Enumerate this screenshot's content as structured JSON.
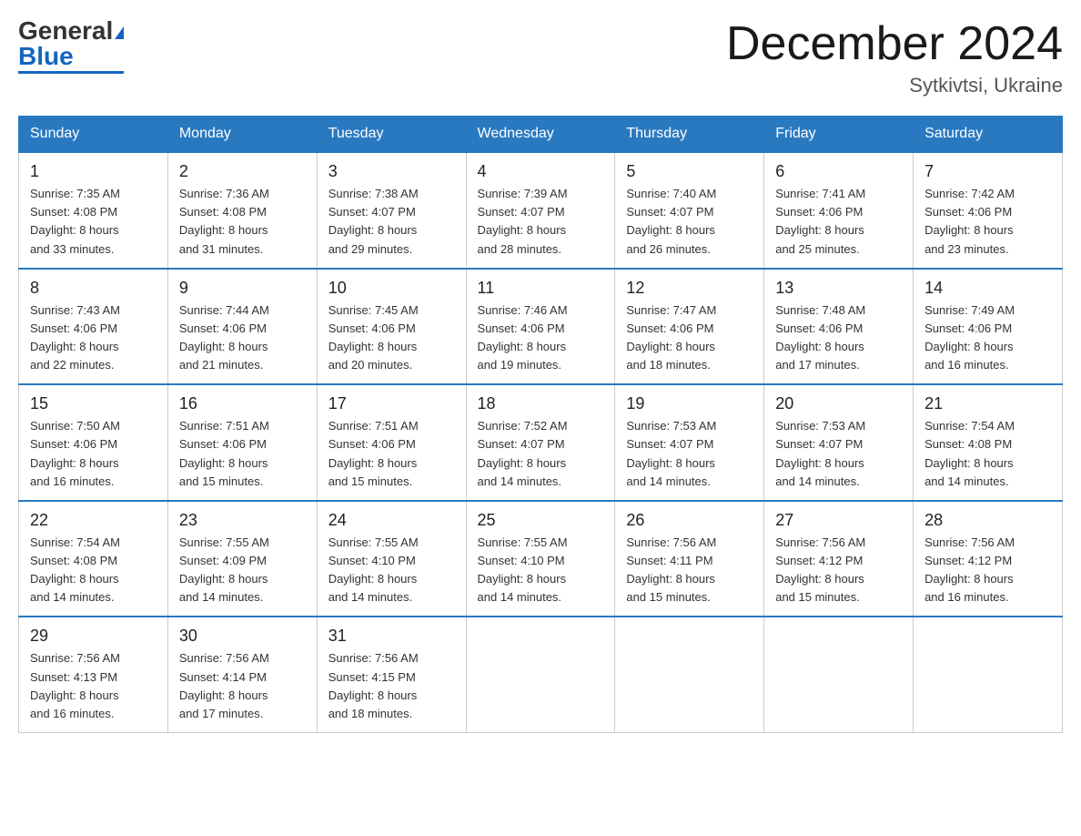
{
  "header": {
    "logo_general": "General",
    "logo_blue": "Blue",
    "month_title": "December 2024",
    "location": "Sytkivtsi, Ukraine"
  },
  "weekdays": [
    "Sunday",
    "Monday",
    "Tuesday",
    "Wednesday",
    "Thursday",
    "Friday",
    "Saturday"
  ],
  "weeks": [
    [
      {
        "day": "1",
        "sunrise": "7:35 AM",
        "sunset": "4:08 PM",
        "daylight": "8 hours and 33 minutes."
      },
      {
        "day": "2",
        "sunrise": "7:36 AM",
        "sunset": "4:08 PM",
        "daylight": "8 hours and 31 minutes."
      },
      {
        "day": "3",
        "sunrise": "7:38 AM",
        "sunset": "4:07 PM",
        "daylight": "8 hours and 29 minutes."
      },
      {
        "day": "4",
        "sunrise": "7:39 AM",
        "sunset": "4:07 PM",
        "daylight": "8 hours and 28 minutes."
      },
      {
        "day": "5",
        "sunrise": "7:40 AM",
        "sunset": "4:07 PM",
        "daylight": "8 hours and 26 minutes."
      },
      {
        "day": "6",
        "sunrise": "7:41 AM",
        "sunset": "4:06 PM",
        "daylight": "8 hours and 25 minutes."
      },
      {
        "day": "7",
        "sunrise": "7:42 AM",
        "sunset": "4:06 PM",
        "daylight": "8 hours and 23 minutes."
      }
    ],
    [
      {
        "day": "8",
        "sunrise": "7:43 AM",
        "sunset": "4:06 PM",
        "daylight": "8 hours and 22 minutes."
      },
      {
        "day": "9",
        "sunrise": "7:44 AM",
        "sunset": "4:06 PM",
        "daylight": "8 hours and 21 minutes."
      },
      {
        "day": "10",
        "sunrise": "7:45 AM",
        "sunset": "4:06 PM",
        "daylight": "8 hours and 20 minutes."
      },
      {
        "day": "11",
        "sunrise": "7:46 AM",
        "sunset": "4:06 PM",
        "daylight": "8 hours and 19 minutes."
      },
      {
        "day": "12",
        "sunrise": "7:47 AM",
        "sunset": "4:06 PM",
        "daylight": "8 hours and 18 minutes."
      },
      {
        "day": "13",
        "sunrise": "7:48 AM",
        "sunset": "4:06 PM",
        "daylight": "8 hours and 17 minutes."
      },
      {
        "day": "14",
        "sunrise": "7:49 AM",
        "sunset": "4:06 PM",
        "daylight": "8 hours and 16 minutes."
      }
    ],
    [
      {
        "day": "15",
        "sunrise": "7:50 AM",
        "sunset": "4:06 PM",
        "daylight": "8 hours and 16 minutes."
      },
      {
        "day": "16",
        "sunrise": "7:51 AM",
        "sunset": "4:06 PM",
        "daylight": "8 hours and 15 minutes."
      },
      {
        "day": "17",
        "sunrise": "7:51 AM",
        "sunset": "4:06 PM",
        "daylight": "8 hours and 15 minutes."
      },
      {
        "day": "18",
        "sunrise": "7:52 AM",
        "sunset": "4:07 PM",
        "daylight": "8 hours and 14 minutes."
      },
      {
        "day": "19",
        "sunrise": "7:53 AM",
        "sunset": "4:07 PM",
        "daylight": "8 hours and 14 minutes."
      },
      {
        "day": "20",
        "sunrise": "7:53 AM",
        "sunset": "4:07 PM",
        "daylight": "8 hours and 14 minutes."
      },
      {
        "day": "21",
        "sunrise": "7:54 AM",
        "sunset": "4:08 PM",
        "daylight": "8 hours and 14 minutes."
      }
    ],
    [
      {
        "day": "22",
        "sunrise": "7:54 AM",
        "sunset": "4:08 PM",
        "daylight": "8 hours and 14 minutes."
      },
      {
        "day": "23",
        "sunrise": "7:55 AM",
        "sunset": "4:09 PM",
        "daylight": "8 hours and 14 minutes."
      },
      {
        "day": "24",
        "sunrise": "7:55 AM",
        "sunset": "4:10 PM",
        "daylight": "8 hours and 14 minutes."
      },
      {
        "day": "25",
        "sunrise": "7:55 AM",
        "sunset": "4:10 PM",
        "daylight": "8 hours and 14 minutes."
      },
      {
        "day": "26",
        "sunrise": "7:56 AM",
        "sunset": "4:11 PM",
        "daylight": "8 hours and 15 minutes."
      },
      {
        "day": "27",
        "sunrise": "7:56 AM",
        "sunset": "4:12 PM",
        "daylight": "8 hours and 15 minutes."
      },
      {
        "day": "28",
        "sunrise": "7:56 AM",
        "sunset": "4:12 PM",
        "daylight": "8 hours and 16 minutes."
      }
    ],
    [
      {
        "day": "29",
        "sunrise": "7:56 AM",
        "sunset": "4:13 PM",
        "daylight": "8 hours and 16 minutes."
      },
      {
        "day": "30",
        "sunrise": "7:56 AM",
        "sunset": "4:14 PM",
        "daylight": "8 hours and 17 minutes."
      },
      {
        "day": "31",
        "sunrise": "7:56 AM",
        "sunset": "4:15 PM",
        "daylight": "8 hours and 18 minutes."
      },
      null,
      null,
      null,
      null
    ]
  ],
  "labels": {
    "sunrise_prefix": "Sunrise: ",
    "sunset_prefix": "Sunset: ",
    "daylight_prefix": "Daylight: "
  }
}
